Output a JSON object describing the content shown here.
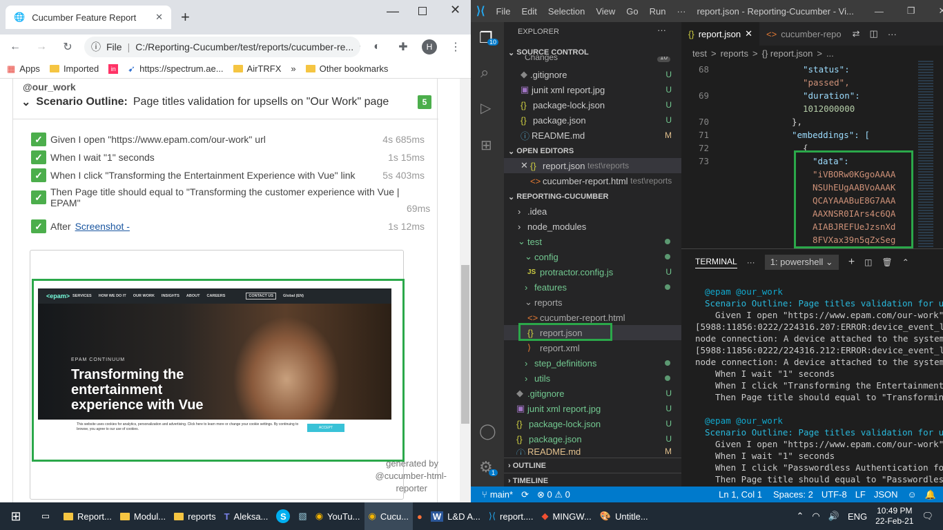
{
  "chrome": {
    "tab_title": "Cucumber Feature Report",
    "url_prefix": "File",
    "url": "C:/Reporting-Cucumber/test/reports/cucumber-re...",
    "profile": "H",
    "bookmarks": [
      "Apps",
      "Imported",
      "https://spectrum.ae...",
      "AirTRFX",
      "»",
      "Other bookmarks"
    ]
  },
  "report": {
    "tag": "@our_work",
    "scenario_keyword": "Scenario Outline:",
    "scenario_title": "Page titles validation for upsells on \"Our Work\" page",
    "step_count": "5",
    "steps": [
      {
        "text": "Given I open \"https://www.epam.com/our-work\" url",
        "duration": "4s 685ms"
      },
      {
        "text": "When I wait \"1\" seconds",
        "duration": "1s 15ms"
      },
      {
        "text": "When I click \"Transforming the Entertainment Experience with Vue\" link",
        "duration": "5s 403ms"
      },
      {
        "text": "Then Page title should equal to \"Transforming the customer experience with Vue | EPAM\"",
        "duration": "69ms"
      }
    ],
    "after_label": "After",
    "after_link": "Screenshot -",
    "after_duration": "1s 12ms",
    "screenshot": {
      "logo": "<epam>",
      "nav": [
        "SERVICES",
        "HOW WE DO IT",
        "OUR WORK",
        "INSIGHTS",
        "ABOUT",
        "CAREERS"
      ],
      "contact": "CONTACT US",
      "global": "Global (EN)",
      "eyebrow": "EPAM CONTINUUM",
      "headline1": "Transforming the",
      "headline2": "entertainment",
      "headline3": "experience with Vue",
      "cookie": "This website uses cookies for analytics, personalization and advertising. Click here to learn more or change your cookie settings. By continuing to browse, you agree to our use of cookies.",
      "accept": "ACCEPT"
    },
    "generated1": "generated by",
    "generated2": "@cucumber-html-",
    "generated3": "reporter"
  },
  "vscode": {
    "menu": [
      "File",
      "Edit",
      "Selection",
      "View",
      "Go",
      "Run",
      "···"
    ],
    "title": "report.json - Reporting-Cucumber - Vi...",
    "activity_badges": {
      "scm": "10",
      "settings": "1"
    },
    "explorer_title": "EXPLORER",
    "source_control": "SOURCE CONTROL",
    "changes": "Changes",
    "changes_count": "10",
    "scm_files": [
      {
        "name": ".gitignore",
        "badge": "U"
      },
      {
        "name": "junit xml report.jpg",
        "badge": "U"
      },
      {
        "name": "package-lock.json",
        "badge": "U"
      },
      {
        "name": "package.json",
        "badge": "U"
      },
      {
        "name": "README.md",
        "badge": "M"
      }
    ],
    "open_editors": "OPEN EDITORS",
    "open_files": [
      {
        "name": "report.json",
        "path": "test\\reports"
      },
      {
        "name": "cucumber-report.html",
        "path": "test\\reports"
      }
    ],
    "project": "REPORTING-CUCUMBER",
    "tree": [
      {
        "name": ".idea",
        "badge": ""
      },
      {
        "name": "node_modules",
        "badge": ""
      },
      {
        "name": "test",
        "badge": ""
      },
      {
        "name": "config",
        "badge": ""
      },
      {
        "name": "protractor.config.js",
        "badge": "U"
      },
      {
        "name": "features",
        "badge": ""
      },
      {
        "name": "reports",
        "badge": ""
      },
      {
        "name": "cucumber-report.html",
        "badge": ""
      },
      {
        "name": "report.json",
        "badge": ""
      },
      {
        "name": "report.xml",
        "badge": ""
      },
      {
        "name": "step_definitions",
        "badge": ""
      },
      {
        "name": "utils",
        "badge": ""
      },
      {
        "name": ".gitignore",
        "badge": "U"
      },
      {
        "name": "junit xml report.jpg",
        "badge": "U"
      },
      {
        "name": "package-lock.json",
        "badge": "U"
      },
      {
        "name": "package.json",
        "badge": "U"
      },
      {
        "name": "README.md",
        "badge": "M"
      }
    ],
    "outline": "OUTLINE",
    "timeline": "TIMELINE",
    "tabs": [
      "report.json",
      "cucumber-repo"
    ],
    "breadcrumb": [
      "test",
      ">",
      "reports",
      ">",
      "{} report.json",
      ">",
      "..."
    ],
    "code": [
      {
        "ln": "68",
        "text": "\"status\":"
      },
      {
        "ln": "",
        "text": "\"passed\","
      },
      {
        "ln": "69",
        "text": "\"duration\":"
      },
      {
        "ln": "",
        "text": "1012000000"
      },
      {
        "ln": "70",
        "text": "},"
      },
      {
        "ln": "71",
        "text": "\"embeddings\": ["
      },
      {
        "ln": "72",
        "text": "{"
      },
      {
        "ln": "73",
        "text": "\"data\":"
      },
      {
        "ln": "",
        "text": "\"iVBORw0KGgoAAAA"
      },
      {
        "ln": "",
        "text": "NSUhEUgAABVoAAAK"
      },
      {
        "ln": "",
        "text": "QCAYAAABuE8G7AAA"
      },
      {
        "ln": "",
        "text": "AAXNSR0IArs4c6QA"
      },
      {
        "ln": "",
        "text": "AIABJREFUeJzsnXd"
      },
      {
        "ln": "",
        "text": "8FVXax39n5qZxSeg"
      }
    ],
    "terminal_tab": "TERMINAL",
    "terminal_more": "···",
    "terminal_select": "1: powershell",
    "terminal_lines": [
      "@epam @our_work",
      "Scenario Outline: Page titles validation for u",
      "  Given I open \"https://www.epam.com/our-work\"",
      "[5988:11856:0222/224316.207:ERROR:device_event_l",
      "node connection: A device attached to the system",
      "[5988:11856:0222/224316.212:ERROR:device_event_l",
      "node connection: A device attached to the system",
      "  When I wait \"1\" seconds",
      "  When I click \"Transforming the Entertainment",
      "  Then Page title should equal to \"Transformin",
      "",
      "@epam @our_work",
      "Scenario Outline: Page titles validation for u",
      "  Given I open \"https://www.epam.com/our-work\"",
      "  When I wait \"1\" seconds",
      "  When I click \"Passwordless Authentication fo",
      "  Then Page title should equal to \"Passwordles"
    ],
    "status": {
      "branch": "main*",
      "errors": "⊗ 0 ⚠ 0",
      "position": "Ln 1, Col 1",
      "spaces": "Spaces: 2",
      "encoding": "UTF-8",
      "eol": "LF",
      "lang": "JSON"
    }
  },
  "taskbar": {
    "items": [
      "Report...",
      "Modul...",
      "reports",
      "Aleksa...",
      "",
      "",
      "YouTu...",
      "Cucu...",
      "",
      "L&D A...",
      "report....",
      "MINGW...",
      "Untitle..."
    ],
    "lang": "ENG",
    "time": "10:49 PM",
    "date": "22-Feb-21"
  },
  "colors": {
    "accent_green": "#2ba84a",
    "vscode_blue": "#007acc",
    "taskbar": "#1f2a35"
  }
}
